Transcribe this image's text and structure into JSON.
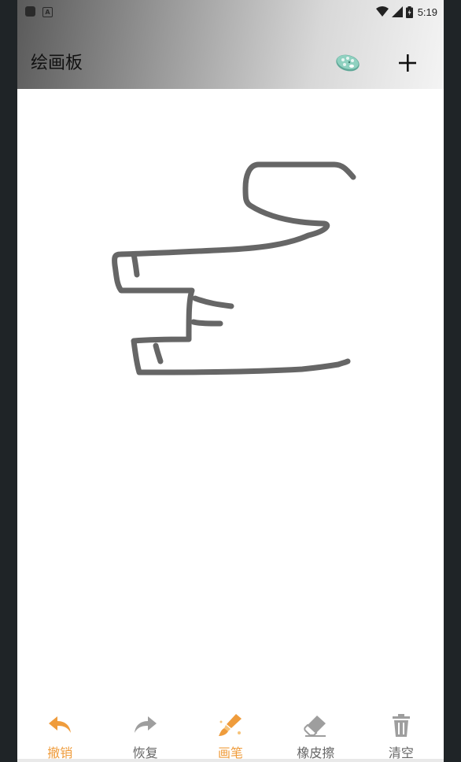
{
  "status_bar": {
    "notification_badge": "A",
    "time": "5:19"
  },
  "app_bar": {
    "title": "绘画板"
  },
  "toolbar": {
    "items": [
      {
        "label": "撤销",
        "icon": "undo-icon",
        "active": true
      },
      {
        "label": "恢复",
        "icon": "redo-icon",
        "active": false
      },
      {
        "label": "画笔",
        "icon": "brush-icon",
        "active": true
      },
      {
        "label": "橡皮擦",
        "icon": "eraser-icon",
        "active": false
      },
      {
        "label": "清空",
        "icon": "trash-icon",
        "active": false
      }
    ]
  },
  "colors": {
    "accent": "#ef9c3c",
    "inactive": "#666666",
    "stroke": "#666666",
    "icon_gray": "#9e9e9e"
  }
}
